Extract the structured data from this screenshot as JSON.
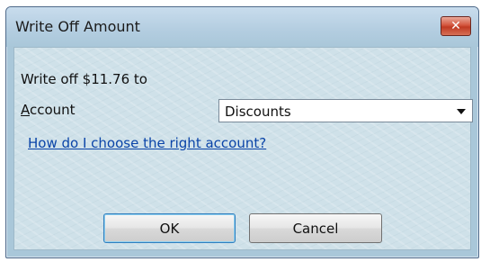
{
  "window": {
    "title": "Write Off Amount",
    "close_icon": "close-icon"
  },
  "form": {
    "writeoff_text": "Write off $11.76 to",
    "account_label_accel": "A",
    "account_label_rest": "ccount",
    "account_value": "Discounts",
    "help_link": "How do I choose the right account?"
  },
  "buttons": {
    "ok": "OK",
    "cancel": "Cancel"
  },
  "colors": {
    "link": "#0a44a8",
    "close_button": "#c03a22",
    "dialog_background": "#cfe1e9"
  }
}
